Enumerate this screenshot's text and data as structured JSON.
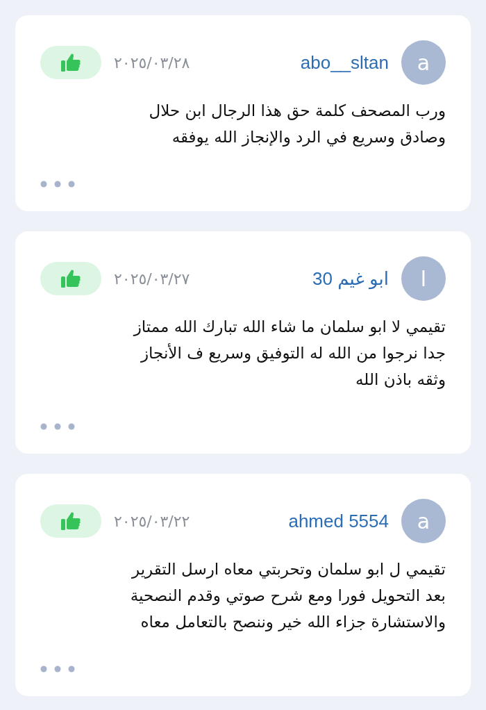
{
  "reviews": [
    {
      "avatar_letter": "a",
      "username": "abo__sltan",
      "date": "٢٠٢٥/٠٣/٢٨",
      "text": "ورب المصحف كلمة حق هذا الرجال ابن حلال\nوصادق وسريع في الرد والإنجاز الله يوفقه"
    },
    {
      "avatar_letter": "ا",
      "username": "ابو غيم 30",
      "date": "٢٠٢٥/٠٣/٢٧",
      "text": "تقيمي لا ابو سلمان ما شاء الله تبارك الله ممتاز\nجدا نرجوا من الله له التوفيق وسريع ف الأنجاز\nوثقه باذن الله"
    },
    {
      "avatar_letter": "a",
      "username": "ahmed 5554",
      "date": "٢٠٢٥/٠٣/٢٢",
      "text": "تقيمي ل ابو سلمان وتحربتي معاه ارسل التقرير\nبعد التحويل فورا ومع شرح صوتي وقدم النصحية\nوالاستشارة جزاء الله خير وننصح بالتعامل معاه"
    }
  ]
}
